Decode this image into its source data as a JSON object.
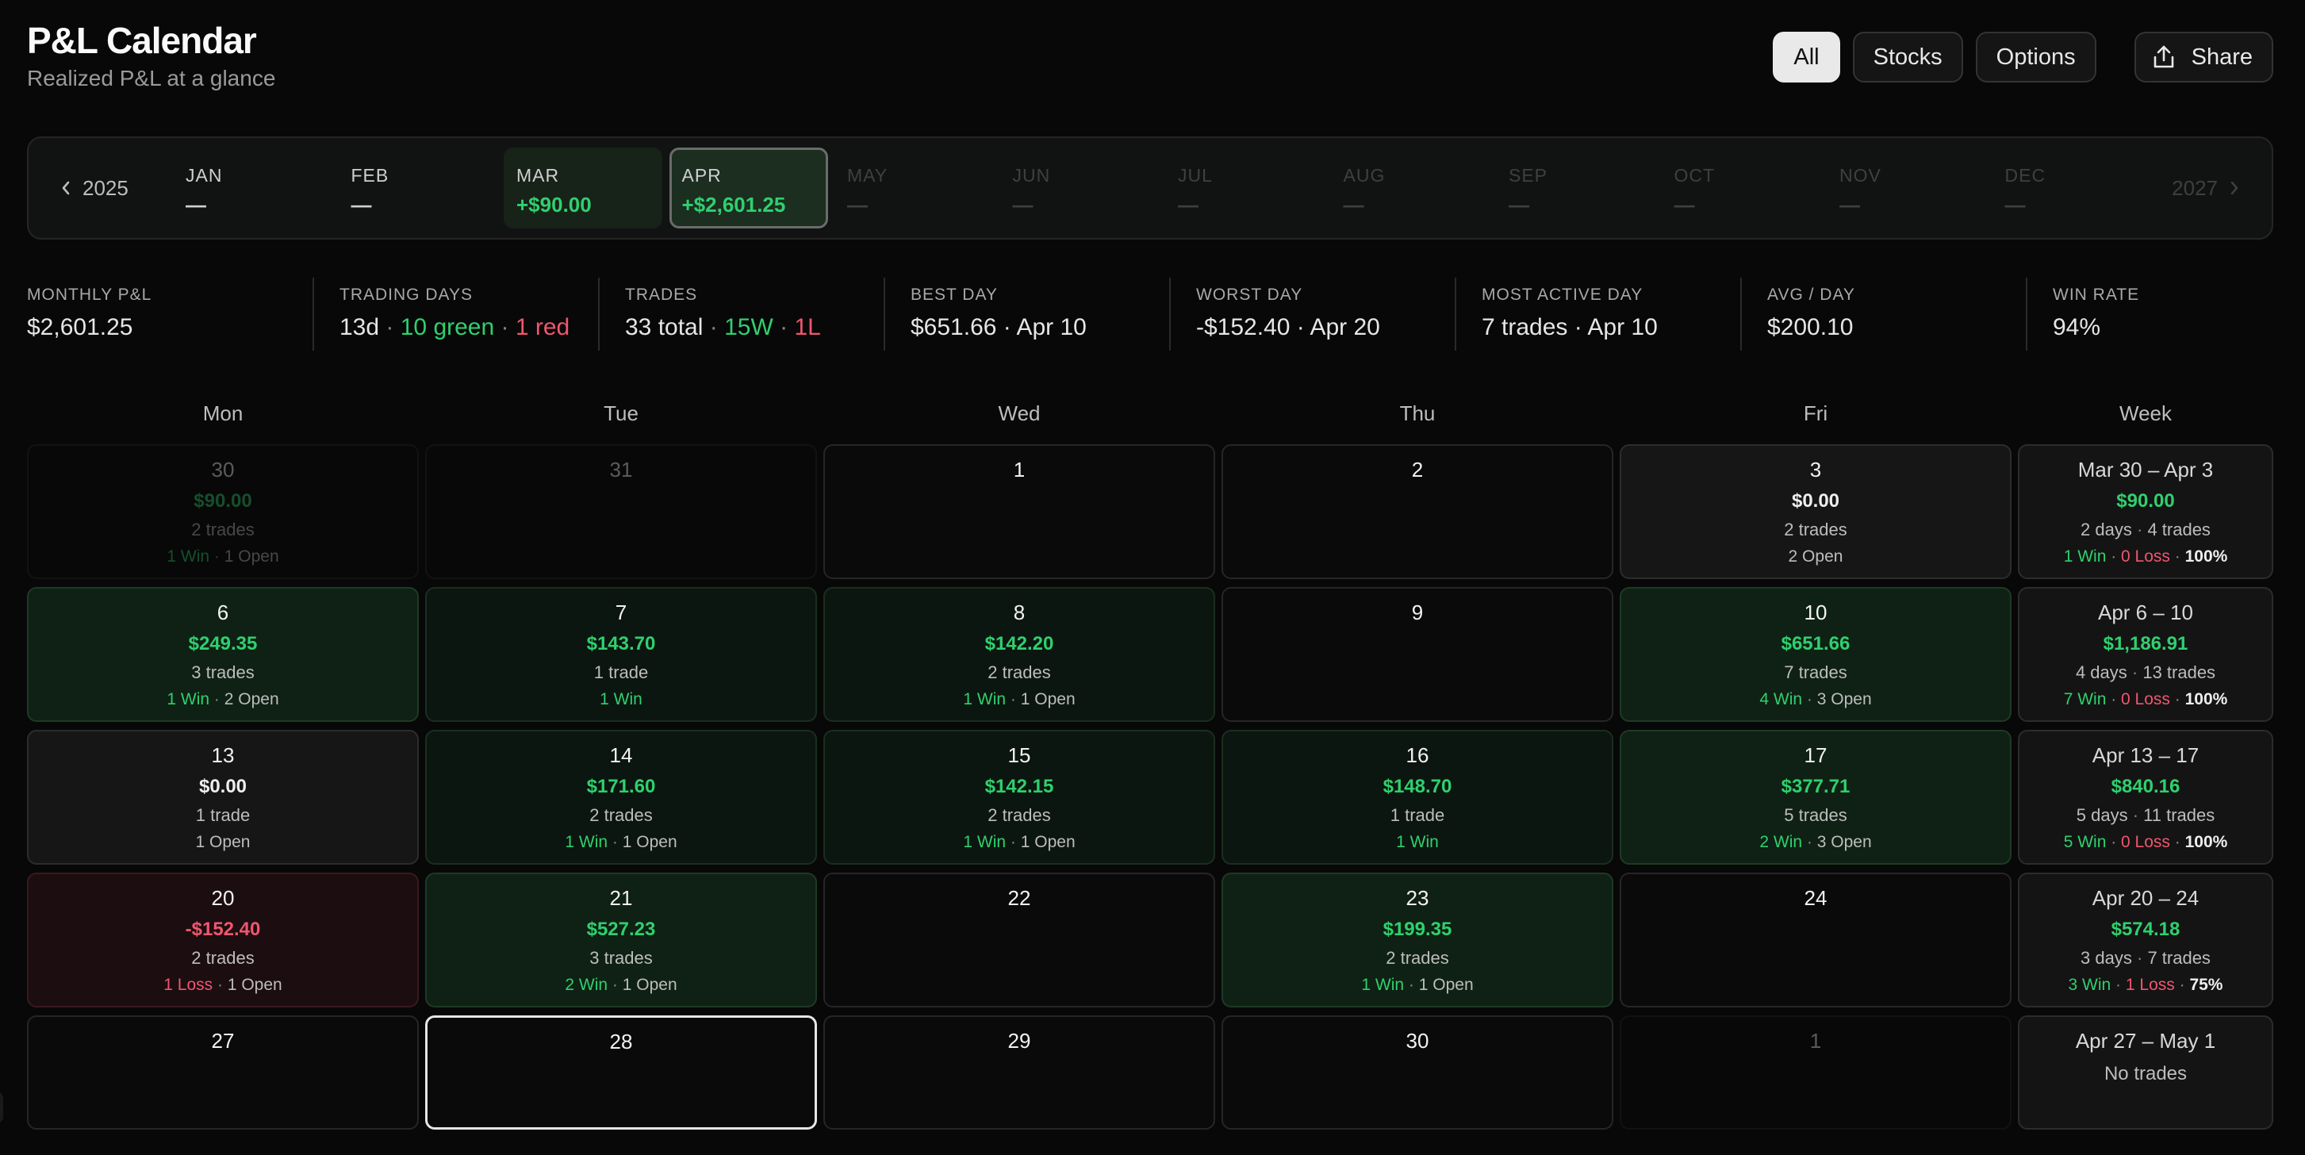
{
  "header": {
    "title": "P&L Calendar",
    "subtitle": "Realized P&L at a glance"
  },
  "filters": {
    "all": "All",
    "stocks": "Stocks",
    "options": "Options",
    "share": "Share",
    "active": "All"
  },
  "year_nav": {
    "prev_year": "2025",
    "next_year": "2027"
  },
  "months": [
    {
      "name": "JAN",
      "value": "—",
      "state": "plain"
    },
    {
      "name": "FEB",
      "value": "—",
      "state": "plain"
    },
    {
      "name": "MAR",
      "value": "+$90.00",
      "state": "has"
    },
    {
      "name": "APR",
      "value": "+$2,601.25",
      "state": "selected"
    },
    {
      "name": "MAY",
      "value": "—",
      "state": "dim"
    },
    {
      "name": "JUN",
      "value": "—",
      "state": "dim"
    },
    {
      "name": "JUL",
      "value": "—",
      "state": "dim"
    },
    {
      "name": "AUG",
      "value": "—",
      "state": "dim"
    },
    {
      "name": "SEP",
      "value": "—",
      "state": "dim"
    },
    {
      "name": "OCT",
      "value": "—",
      "state": "dim"
    },
    {
      "name": "NOV",
      "value": "—",
      "state": "dim"
    },
    {
      "name": "DEC",
      "value": "—",
      "state": "dim"
    }
  ],
  "stats": {
    "monthly_pnl": {
      "label": "MONTHLY P&L",
      "value": "$2,601.25"
    },
    "trading_days": {
      "label": "TRADING DAYS",
      "days": "13d",
      "sep": " · ",
      "green": "10 green",
      "red": "1 red"
    },
    "trades": {
      "label": "TRADES",
      "total": "33 total",
      "sep": " · ",
      "wins": "15W",
      "losses": "1L"
    },
    "best_day": {
      "label": "BEST DAY",
      "value": "$651.66 · Apr 10"
    },
    "worst_day": {
      "label": "WORST DAY",
      "value": "-$152.40 · Apr 20"
    },
    "most_active": {
      "label": "MOST ACTIVE DAY",
      "value": "7 trades · Apr 10"
    },
    "avg_day": {
      "label": "AVG / DAY",
      "value": "$200.10"
    },
    "win_rate": {
      "label": "WIN RATE",
      "value": "94%"
    }
  },
  "weekdays": [
    "Mon",
    "Tue",
    "Wed",
    "Thu",
    "Fri",
    "Week"
  ],
  "weeks": [
    {
      "days": [
        {
          "day": "30",
          "pnl": "$90.00",
          "pnl_tone": "green",
          "trades": "2 trades",
          "wins": "1 Win",
          "losses": "",
          "open": "1 Open",
          "style": "faded"
        },
        {
          "day": "31",
          "pnl": "",
          "pnl_tone": "",
          "trades": "",
          "wins": "",
          "losses": "",
          "open": "",
          "style": "faded"
        },
        {
          "day": "1",
          "pnl": "",
          "pnl_tone": "",
          "trades": "",
          "wins": "",
          "losses": "",
          "open": "",
          "style": "empty"
        },
        {
          "day": "2",
          "pnl": "",
          "pnl_tone": "",
          "trades": "",
          "wins": "",
          "losses": "",
          "open": "",
          "style": "empty"
        },
        {
          "day": "3",
          "pnl": "$0.00",
          "pnl_tone": "white",
          "trades": "2 trades",
          "wins": "",
          "losses": "",
          "open": "2 Open",
          "style": "flat"
        }
      ],
      "summary": {
        "range": "Mar 30 – Apr 3",
        "pnl": "$90.00",
        "pnl_tone": "green",
        "days": "2 days",
        "trades": "4 trades",
        "wins": "1 Win",
        "losses": "0 Loss",
        "rate": "100%"
      }
    },
    {
      "days": [
        {
          "day": "6",
          "pnl": "$249.35",
          "pnl_tone": "green",
          "trades": "3 trades",
          "wins": "1 Win",
          "losses": "",
          "open": "2 Open",
          "style": "profit"
        },
        {
          "day": "7",
          "pnl": "$143.70",
          "pnl_tone": "green",
          "trades": "1 trade",
          "wins": "1 Win",
          "losses": "",
          "open": "",
          "style": "profit-light"
        },
        {
          "day": "8",
          "pnl": "$142.20",
          "pnl_tone": "green",
          "trades": "2 trades",
          "wins": "1 Win",
          "losses": "",
          "open": "1 Open",
          "style": "profit-light"
        },
        {
          "day": "9",
          "pnl": "",
          "pnl_tone": "",
          "trades": "",
          "wins": "",
          "losses": "",
          "open": "",
          "style": "empty"
        },
        {
          "day": "10",
          "pnl": "$651.66",
          "pnl_tone": "green",
          "trades": "7 trades",
          "wins": "4 Win",
          "losses": "",
          "open": "3 Open",
          "style": "profit"
        }
      ],
      "summary": {
        "range": "Apr 6 – 10",
        "pnl": "$1,186.91",
        "pnl_tone": "green",
        "days": "4 days",
        "trades": "13 trades",
        "wins": "7 Win",
        "losses": "0 Loss",
        "rate": "100%"
      }
    },
    {
      "days": [
        {
          "day": "13",
          "pnl": "$0.00",
          "pnl_tone": "white",
          "trades": "1 trade",
          "wins": "",
          "losses": "",
          "open": "1 Open",
          "style": "flat"
        },
        {
          "day": "14",
          "pnl": "$171.60",
          "pnl_tone": "green",
          "trades": "2 trades",
          "wins": "1 Win",
          "losses": "",
          "open": "1 Open",
          "style": "profit-light"
        },
        {
          "day": "15",
          "pnl": "$142.15",
          "pnl_tone": "green",
          "trades": "2 trades",
          "wins": "1 Win",
          "losses": "",
          "open": "1 Open",
          "style": "profit-light"
        },
        {
          "day": "16",
          "pnl": "$148.70",
          "pnl_tone": "green",
          "trades": "1 trade",
          "wins": "1 Win",
          "losses": "",
          "open": "",
          "style": "profit-light"
        },
        {
          "day": "17",
          "pnl": "$377.71",
          "pnl_tone": "green",
          "trades": "5 trades",
          "wins": "2 Win",
          "losses": "",
          "open": "3 Open",
          "style": "profit"
        }
      ],
      "summary": {
        "range": "Apr 13 – 17",
        "pnl": "$840.16",
        "pnl_tone": "green",
        "days": "5 days",
        "trades": "11 trades",
        "wins": "5 Win",
        "losses": "0 Loss",
        "rate": "100%"
      }
    },
    {
      "days": [
        {
          "day": "20",
          "pnl": "-$152.40",
          "pnl_tone": "red",
          "trades": "2 trades",
          "wins": "",
          "losses": "1 Loss",
          "open": "1 Open",
          "style": "loss"
        },
        {
          "day": "21",
          "pnl": "$527.23",
          "pnl_tone": "green",
          "trades": "3 trades",
          "wins": "2 Win",
          "losses": "",
          "open": "1 Open",
          "style": "profit"
        },
        {
          "day": "22",
          "pnl": "",
          "pnl_tone": "",
          "trades": "",
          "wins": "",
          "losses": "",
          "open": "",
          "style": "empty"
        },
        {
          "day": "23",
          "pnl": "$199.35",
          "pnl_tone": "green",
          "trades": "2 trades",
          "wins": "1 Win",
          "losses": "",
          "open": "1 Open",
          "style": "profit"
        },
        {
          "day": "24",
          "pnl": "",
          "pnl_tone": "",
          "trades": "",
          "wins": "",
          "losses": "",
          "open": "",
          "style": "empty"
        }
      ],
      "summary": {
        "range": "Apr 20 – 24",
        "pnl": "$574.18",
        "pnl_tone": "green",
        "days": "3 days",
        "trades": "7 trades",
        "wins": "3 Win",
        "losses": "1 Loss",
        "rate": "75%"
      }
    },
    {
      "days": [
        {
          "day": "27",
          "pnl": "",
          "pnl_tone": "",
          "trades": "",
          "wins": "",
          "losses": "",
          "open": "",
          "style": "empty"
        },
        {
          "day": "28",
          "pnl": "",
          "pnl_tone": "",
          "trades": "",
          "wins": "",
          "losses": "",
          "open": "",
          "style": "today"
        },
        {
          "day": "29",
          "pnl": "",
          "pnl_tone": "",
          "trades": "",
          "wins": "",
          "losses": "",
          "open": "",
          "style": "empty"
        },
        {
          "day": "30",
          "pnl": "",
          "pnl_tone": "",
          "trades": "",
          "wins": "",
          "losses": "",
          "open": "",
          "style": "empty"
        },
        {
          "day": "1",
          "pnl": "",
          "pnl_tone": "",
          "trades": "",
          "wins": "",
          "losses": "",
          "open": "",
          "style": "faded"
        }
      ],
      "summary": {
        "range": "Apr 27 – May 1",
        "pnl": "",
        "pnl_tone": "",
        "days": "",
        "trades": "",
        "wins": "",
        "losses": "",
        "rate": "",
        "empty_text": "No trades"
      }
    }
  ],
  "colors": {
    "green": "#2fd06e",
    "red": "#f0566e",
    "background": "#080808"
  },
  "icons": {
    "share": "share-icon",
    "prev_year": "chevron-left-icon",
    "next_year": "chevron-right-icon"
  }
}
